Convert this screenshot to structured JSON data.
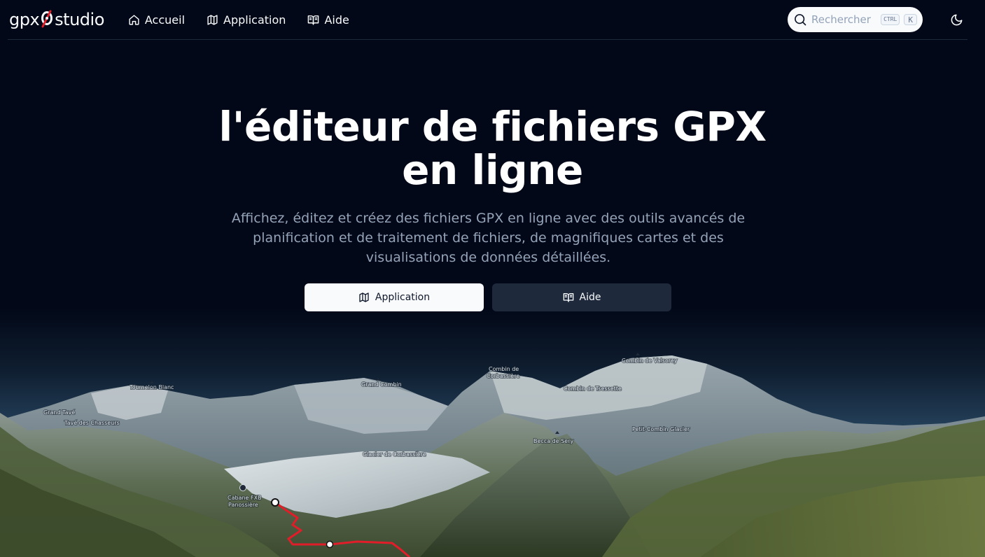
{
  "header": {
    "logo_text_left": "gpx",
    "logo_text_right": "studio",
    "nav": [
      {
        "label": "Accueil",
        "icon": "home-icon"
      },
      {
        "label": "Application",
        "icon": "map-icon"
      },
      {
        "label": "Aide",
        "icon": "book-open-icon"
      }
    ],
    "search": {
      "placeholder": "Rechercher",
      "shortcut_mod": "CTRL",
      "shortcut_key": "K"
    },
    "theme_toggle_icon": "moon-icon"
  },
  "hero": {
    "title_line1": "l'éditeur de fichiers GPX",
    "title_line2": "en ligne",
    "subtitle": "Affichez, éditez et créez des fichiers GPX en ligne avec des outils avancés de planification et de traitement de fichiers, de magnifiques cartes et des visualisations de données détaillées.",
    "buttons": [
      {
        "label": "Application",
        "icon": "map-icon",
        "style": "primary"
      },
      {
        "label": "Aide",
        "icon": "book-open-icon",
        "style": "secondary"
      }
    ]
  },
  "map": {
    "places": {
      "tournelon_blanc": "Tournelon Blanc",
      "grand_tave": "Grand Tavé",
      "tave_chasseurs": "Tavé des Chasseurs",
      "grand_combin": "Grand Combin",
      "combin_corbassiere": "Combin de\nCorbassière",
      "combin_tsessette": "Combin de Tsessette",
      "combin_valsorey": "Combin de Valsorey",
      "petit_combin_glacier": "Petit-Combin Glacier",
      "becca_sery": "Becca de Sery",
      "glacier_corbassiere": "Glacier de Corbassière",
      "cabane_line1": "Cabane FXB",
      "cabane_line2": "Panossière"
    },
    "track_color": "#e11d2a"
  }
}
